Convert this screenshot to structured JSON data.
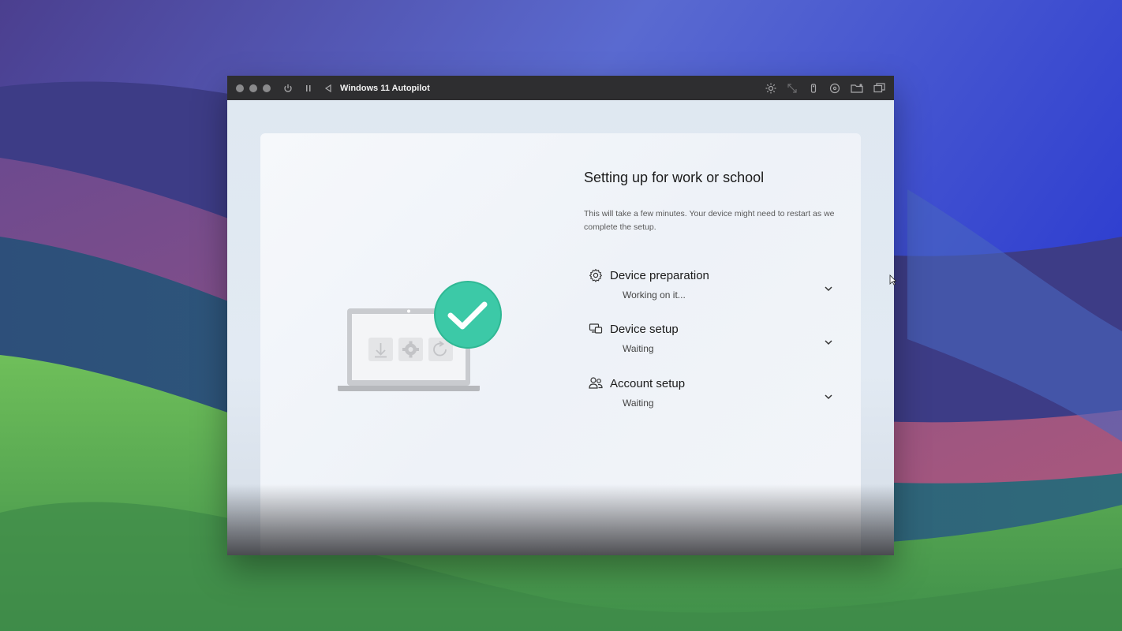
{
  "window": {
    "title": "Windows 11 Autopilot",
    "toolbar_left_icons": [
      "power-icon",
      "pause-icon",
      "back-icon"
    ],
    "toolbar_right_icons": [
      "brightness-icon",
      "resize-icon",
      "usb-icon",
      "disc-icon",
      "folder-share-icon",
      "windows-overlap-icon"
    ]
  },
  "setup": {
    "heading": "Setting up for work or school",
    "subtitle": "This will take a few minutes. Your device might need to restart as we complete the setup.",
    "steps": [
      {
        "name": "Device preparation",
        "status": "Working on it...",
        "icon": "gear-icon"
      },
      {
        "name": "Device setup",
        "status": "Waiting",
        "icon": "devices-icon"
      },
      {
        "name": "Account setup",
        "status": "Waiting",
        "icon": "people-icon"
      }
    ]
  },
  "colors": {
    "accent_check": "#3cc9a7",
    "titlebar": "#2e2e30"
  }
}
